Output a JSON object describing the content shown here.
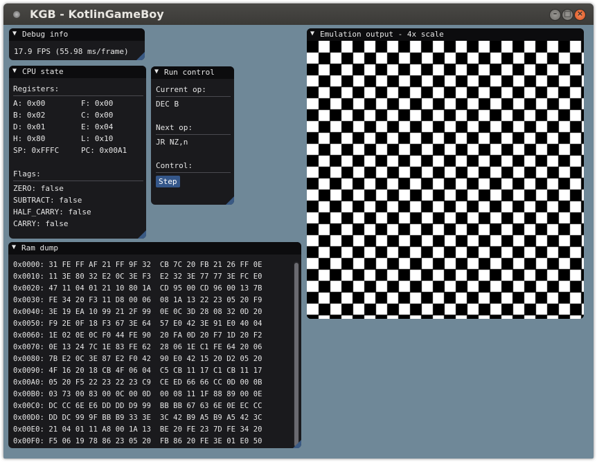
{
  "window": {
    "title": "KGB - KotlinGameBoy",
    "minimize": "–",
    "maximize": "□",
    "close": "×"
  },
  "debug": {
    "title": "Debug info",
    "fps": "17.9 FPS (55.98 ms/frame)"
  },
  "cpu": {
    "title": "CPU state",
    "registers_label": "Registers:",
    "registers": [
      [
        "A: 0x00",
        "F: 0x00"
      ],
      [
        "B: 0x02",
        "C: 0x00"
      ],
      [
        "D: 0x01",
        "E: 0x04"
      ],
      [
        "H: 0x80",
        "L: 0x10"
      ],
      [
        "SP: 0xFFFC",
        "PC: 0x00A1"
      ]
    ],
    "flags_label": "Flags:",
    "flags": [
      "ZERO: false",
      "SUBTRACT: false",
      "HALF_CARRY: false",
      "CARRY: false"
    ]
  },
  "run": {
    "title": "Run control",
    "current_label": "Current op:",
    "current_op": "DEC B",
    "next_label": "Next op:",
    "next_op": "JR NZ,n",
    "control_label": "Control:",
    "step_label": "Step"
  },
  "ram": {
    "title": "Ram dump",
    "rows": [
      "0x0000: 31 FE FF AF 21 FF 9F 32  CB 7C 20 FB 21 26 FF 0E",
      "0x0010: 11 3E 80 32 E2 0C 3E F3  E2 32 3E 77 77 3E FC E0",
      "0x0020: 47 11 04 01 21 10 80 1A  CD 95 00 CD 96 00 13 7B",
      "0x0030: FE 34 20 F3 11 D8 00 06  08 1A 13 22 23 05 20 F9",
      "0x0040: 3E 19 EA 10 99 21 2F 99  0E 0C 3D 28 08 32 0D 20",
      "0x0050: F9 2E 0F 18 F3 67 3E 64  57 E0 42 3E 91 E0 40 04",
      "0x0060: 1E 02 0E 0C F0 44 FE 90  20 FA 0D 20 F7 1D 20 F2",
      "0x0070: 0E 13 24 7C 1E 83 FE 62  28 06 1E C1 FE 64 20 06",
      "0x0080: 7B E2 0C 3E 87 E2 F0 42  90 E0 42 15 20 D2 05 20",
      "0x0090: 4F 16 20 18 CB 4F 06 04  C5 CB 11 17 C1 CB 11 17",
      "0x00A0: 05 20 F5 22 23 22 23 C9  CE ED 66 66 CC 0D 00 0B",
      "0x00B0: 03 73 00 83 00 0C 00 0D  00 08 11 1F 88 89 00 0E",
      "0x00C0: DC CC 6E E6 DD DD D9 99  BB BB 67 63 6E 0E EC CC",
      "0x00D0: DD DC 99 9F BB B9 33 3E  3C 42 B9 A5 B9 A5 42 3C",
      "0x00E0: 21 04 01 11 A8 00 1A 13  BE 20 FE 23 7D FE 34 20",
      "0x00F0: F5 06 19 78 86 23 05 20  FB 86 20 FE 3E 01 E0 50"
    ]
  },
  "emu": {
    "title": "Emulation output - 4x scale",
    "pattern": "checkerboard",
    "color_dark": "#000000",
    "color_light": "#ffffff"
  },
  "colors": {
    "accent": "#35578a",
    "window_bg": "#6f8898",
    "panel_bg": "#1a1a1d"
  }
}
